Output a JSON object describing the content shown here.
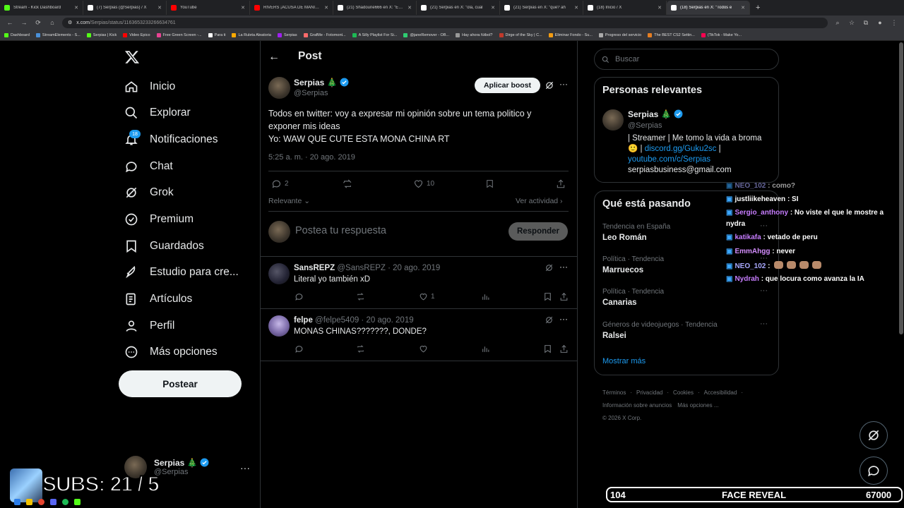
{
  "browser": {
    "tabs": [
      {
        "title": "Stream - Kick Dashboard",
        "color": "#53fc18"
      },
      {
        "title": "(7) Serpias (@Serpias) / X",
        "color": "#ffffff"
      },
      {
        "title": "YouTube",
        "color": "#ff0000"
      },
      {
        "title": "RIVERS ¡ACUSA DE MANIPULAR",
        "color": "#ff0000"
      },
      {
        "title": "(21) Shadoune666 en X: \"Estoy",
        "color": "#ffffff"
      },
      {
        "title": "(21) Serpias en X: \"ola, cual",
        "color": "#ffffff"
      },
      {
        "title": "(21) Serpias en X: \"que? ah",
        "color": "#ffffff"
      },
      {
        "title": "(18) Inicio / X",
        "color": "#ffffff"
      },
      {
        "title": "(18) Serpias en X: \"Todos e",
        "color": "#ffffff",
        "active": true
      }
    ],
    "new_tab": "+",
    "url": "x.com",
    "url_path": "/Serpias/status/1163653233266634761",
    "bookmarks": [
      "Dashboard",
      "StreamElements - S...",
      "Serpias | Kick",
      "Video Epico",
      "Free Green Screen -...",
      "Para ti",
      "La Ruleta Aleatoria",
      "Serpias",
      "GrafMe - Fotomont...",
      "A Silly Playlist For Si...",
      "@janeRemover - OB...",
      "Hay ahora fútbol?",
      "Dirge of the Sky | C...",
      "Eliminar Fondo - Su...",
      "Progreso del servicio",
      "The BEST CS2 Settin...",
      "(TikTok - Make Yo..."
    ]
  },
  "nav": {
    "items": [
      {
        "label": "Inicio",
        "icon": "home-icon"
      },
      {
        "label": "Explorar",
        "icon": "search-icon"
      },
      {
        "label": "Notificaciones",
        "icon": "bell-icon"
      },
      {
        "label": "Chat",
        "icon": "chat-icon"
      },
      {
        "label": "Grok",
        "icon": "grok-icon"
      },
      {
        "label": "Premium",
        "icon": "premium-icon"
      },
      {
        "label": "Guardados",
        "icon": "bookmark-icon"
      },
      {
        "label": "Estudio para cre...",
        "icon": "rocket-icon"
      },
      {
        "label": "Artículos",
        "icon": "article-icon"
      },
      {
        "label": "Perfil",
        "icon": "person-icon"
      },
      {
        "label": "Más opciones",
        "icon": "more-circle-icon"
      }
    ],
    "notif_count": "18",
    "post_button": "Postear",
    "account": {
      "name": "Serpias",
      "emoji": "🎄",
      "handle": "@Serpias"
    }
  },
  "header": {
    "title": "Post"
  },
  "post": {
    "author": "Serpias",
    "emoji": "🎄",
    "handle": "@Serpias",
    "boost_button": "Aplicar boost",
    "text_line1": "Todos en twitter: voy a expresar mi opinión sobre un tema politico y",
    "text_line2": "exponer mis ideas",
    "text_line3": "Yo: WAW QUE CUTE ESTA MONA CHINA RT",
    "time": "5:25 a. m. · 20 ago. 2019",
    "replies": "2",
    "likes": "10",
    "sort": "Relevante",
    "activity": "Ver actividad"
  },
  "reply_box": {
    "placeholder": "Postea tu respuesta",
    "button": "Responder"
  },
  "replies": [
    {
      "name": "SansREPZ",
      "meta": "@SansREPZ · 20 ago. 2019",
      "text": "Literal yo también xD",
      "likes": "1"
    },
    {
      "name": "felpe",
      "meta": "@felpe5409 · 20 ago. 2019",
      "text": "MONAS CHINAS???????, DONDE?",
      "likes": ""
    }
  ],
  "search": {
    "placeholder": "Buscar"
  },
  "relevant": {
    "title": "Personas relevantes",
    "name": "Serpias",
    "emoji": "🎄",
    "handle": "@Serpias",
    "bio_line1": "| Streamer | Me tomo la vida a broma",
    "bio_emoji": "🙂",
    "bio_link1": "discord.gg/Guku2sc",
    "bio_sep": "|",
    "bio_link2": "youtube.com/c/Serpias",
    "bio_line4": "serpiasbusiness@gmail.com"
  },
  "trends": {
    "title": "Qué está pasando",
    "items": [
      {
        "category": "Tendencia en España",
        "name": "Leo Román"
      },
      {
        "category": "Política · Tendencia",
        "name": "Marruecos"
      },
      {
        "category": "Política · Tendencia",
        "name": "Canarias"
      },
      {
        "category": "Géneros de videojuegos · Tendencia",
        "name": "Ralsei"
      }
    ],
    "more": "Mostrar más"
  },
  "footer": {
    "row1": [
      "Términos",
      "Privacidad",
      "Cookies",
      "Accesibilidad"
    ],
    "row2": [
      "Información sobre anuncios",
      "Más opciones ..."
    ],
    "copyright": "© 2026 X Corp."
  },
  "stream_chat": [
    {
      "user": "NEO_102",
      "msg": ": como?",
      "color": "#a9a9ff"
    },
    {
      "user": "justliikeheaven",
      "msg": ": SI",
      "color": "#ffffff"
    },
    {
      "user": "Sergio_anthony",
      "msg": ": No viste el que le mostre a",
      "color": "#c77dff"
    },
    {
      "user": "",
      "msg": "nydra",
      "color": "#ffffff"
    },
    {
      "user": "katikafa",
      "msg": ": vetado de peru",
      "color": "#c77dff"
    },
    {
      "user": "EmmAhgg",
      "msg": ": never",
      "color": "#d48eff"
    },
    {
      "user": "NEO_102",
      "msg": ":",
      "color": "#a9a9ff"
    },
    {
      "user": "Nydrah",
      "msg": ": que locura como avanza la IA",
      "color": "#c77dff"
    }
  ],
  "stream_overlay": {
    "subs": "SUBS: 21 / 5",
    "left_count": "104",
    "goal": "FACE REVEAL",
    "right_count": "67000"
  }
}
